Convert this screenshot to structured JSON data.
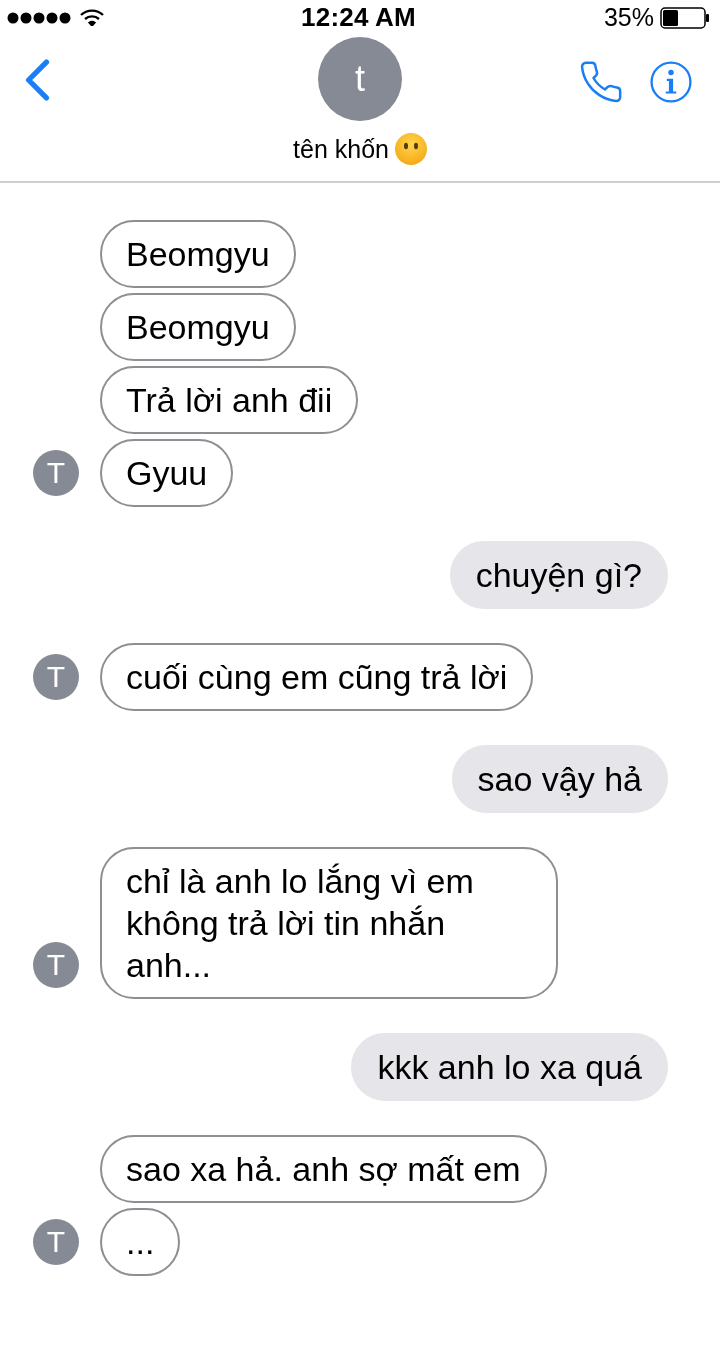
{
  "status_bar": {
    "time": "12:24 AM",
    "battery_percent": "35%"
  },
  "header": {
    "avatar_initial": "t",
    "contact_name": "tên khốn"
  },
  "messages": [
    {
      "kind": "incoming",
      "avatar_initial": "T",
      "bubbles": [
        "Beomgyu",
        "Beomgyu",
        "Trả lời anh đii",
        "Gyuu"
      ]
    },
    {
      "kind": "outgoing",
      "bubbles": [
        "chuyện gì?"
      ]
    },
    {
      "kind": "incoming",
      "avatar_initial": "T",
      "bubbles": [
        "cuối cùng em cũng trả lời"
      ]
    },
    {
      "kind": "outgoing",
      "bubbles": [
        "sao vậy hả"
      ]
    },
    {
      "kind": "incoming",
      "avatar_initial": "T",
      "bubbles": [
        "chỉ là anh lo lắng vì em không trả lời tin nhắn anh..."
      ]
    },
    {
      "kind": "outgoing",
      "bubbles": [
        "kkk anh lo xa quá"
      ]
    },
    {
      "kind": "incoming",
      "avatar_initial": "T",
      "bubbles": [
        "sao xa hả. anh sợ mất em",
        "..."
      ]
    }
  ]
}
